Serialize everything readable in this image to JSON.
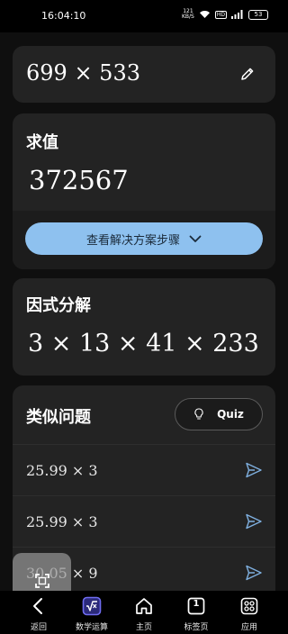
{
  "status": {
    "time": "16:04:10",
    "speed_value": "121",
    "speed_unit": "KB/S",
    "signal_label": "HD",
    "battery": "53"
  },
  "expression": {
    "text": "699 × 533",
    "edit_icon": "pencil-icon"
  },
  "evaluate": {
    "title": "求值",
    "value": "372567",
    "steps_button": "查看解决方案步骤"
  },
  "factorization": {
    "title": "因式分解",
    "value": "3 × 13 × 41 × 233"
  },
  "similar": {
    "title": "类似问题",
    "quiz_label": "Quiz",
    "items": [
      {
        "text": "25.99 × 3"
      },
      {
        "text": "25.99 × 3"
      },
      {
        "text": "30.05 × 9"
      }
    ]
  },
  "nav": {
    "items": [
      {
        "label": "返回",
        "icon": "back-icon"
      },
      {
        "label": "数学运算",
        "icon": "math-solver-icon"
      },
      {
        "label": "主页",
        "icon": "home-icon"
      },
      {
        "label": "标签页",
        "icon": "tabs-icon"
      },
      {
        "label": "应用",
        "icon": "apps-icon"
      }
    ],
    "tab_count": "1"
  },
  "colors": {
    "accent": "#8ec1ef",
    "card": "#232323",
    "background": "#0f0f0f",
    "send_icon": "#7fb0e0"
  }
}
